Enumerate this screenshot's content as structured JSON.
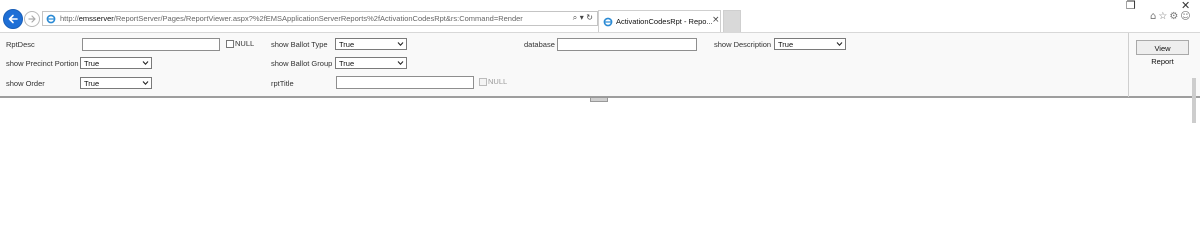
{
  "browser": {
    "url_prefix": "http://",
    "url_host": "emsserver",
    "url_path": "/ReportServer/Pages/ReportViewer.aspx?%2fEMSApplicationServerReports%2fActivationCodesRpt&rs:Command=Render",
    "tab_title": "ActivationCodesRpt - Repo...",
    "address_icons": "⌕ ▾ ↻",
    "window_controls": {
      "restore": "❐",
      "close": "✕"
    },
    "tool_icons": "⌂☆⚙☺"
  },
  "params": {
    "rpt_desc": {
      "label": "RptDesc",
      "value": "",
      "null_label": "NULL"
    },
    "show_ballot_type": {
      "label": "show Ballot Type",
      "value": "True"
    },
    "database": {
      "label": "database",
      "value": ""
    },
    "show_description": {
      "label": "show Description",
      "value": "True"
    },
    "show_precinct_portion": {
      "label": "show Precinct Portion",
      "value": "True"
    },
    "show_ballot_group": {
      "label": "show Ballot Group",
      "value": "True"
    },
    "show_order": {
      "label": "show Order",
      "value": "True"
    },
    "rpt_title": {
      "label": "rptTitle",
      "value": "",
      "null_label": "NULL"
    },
    "view_report_label": "View Report"
  }
}
